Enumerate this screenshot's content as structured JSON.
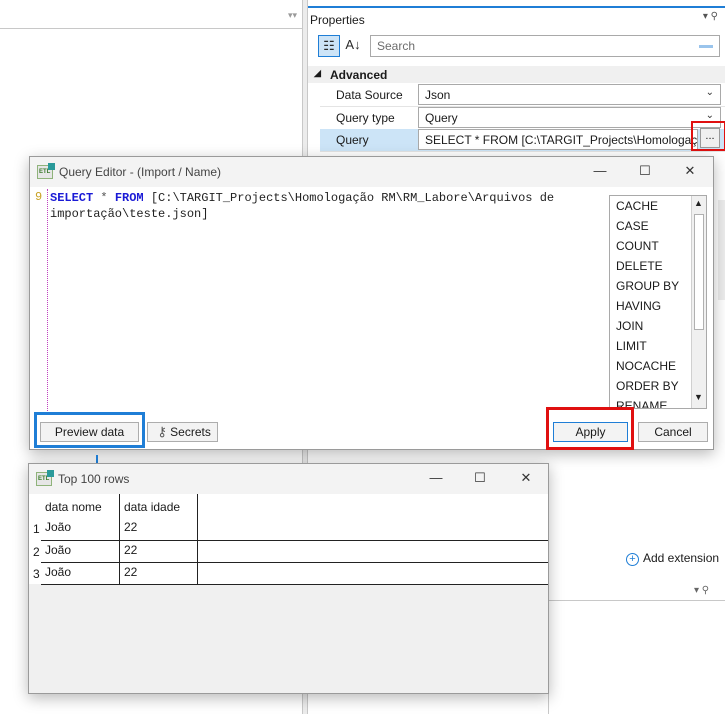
{
  "properties": {
    "title": "Properties",
    "search_placeholder": "Search",
    "category": "Advanced",
    "rows": [
      {
        "key": "Data Source",
        "value": "Json"
      },
      {
        "key": "Query type",
        "value": "Query"
      },
      {
        "key": "Query",
        "value": "SELECT * FROM [C:\\TARGIT_Projects\\Homologação RM"
      }
    ],
    "ellipsis_label": "...",
    "add_extension_label": "Add extension"
  },
  "query_editor": {
    "title": "Query Editor - (Import / Name)",
    "line_number": "9",
    "code_keyword1": "SELECT",
    "code_star": "*",
    "code_keyword2": "FROM",
    "code_path": "[C:\\TARGIT_Projects\\Homologação RM\\RM_Labore\\Arquivos de importação\\teste.json]",
    "keywords": [
      "CACHE",
      "CASE",
      "COUNT",
      "DELETE",
      "GROUP BY",
      "HAVING",
      "JOIN",
      "LIMIT",
      "NOCACHE",
      "ORDER BY",
      "RENAME"
    ],
    "preview_button": "Preview data",
    "secrets_button": "Secrets",
    "apply_button": "Apply",
    "cancel_button": "Cancel"
  },
  "top_rows": {
    "title": "Top 100 rows",
    "columns": [
      "data nome",
      "data idade"
    ],
    "rows": [
      {
        "num": "1",
        "nome": "João",
        "idade": "22"
      },
      {
        "num": "2",
        "nome": "João",
        "idade": "22"
      },
      {
        "num": "3",
        "nome": "João",
        "idade": "22"
      }
    ]
  },
  "colors": {
    "accent": "#1f7ed6",
    "highlight_red": "#e01010",
    "keyword_blue": "#1a1ad6",
    "selected_row": "#cce4f7"
  }
}
